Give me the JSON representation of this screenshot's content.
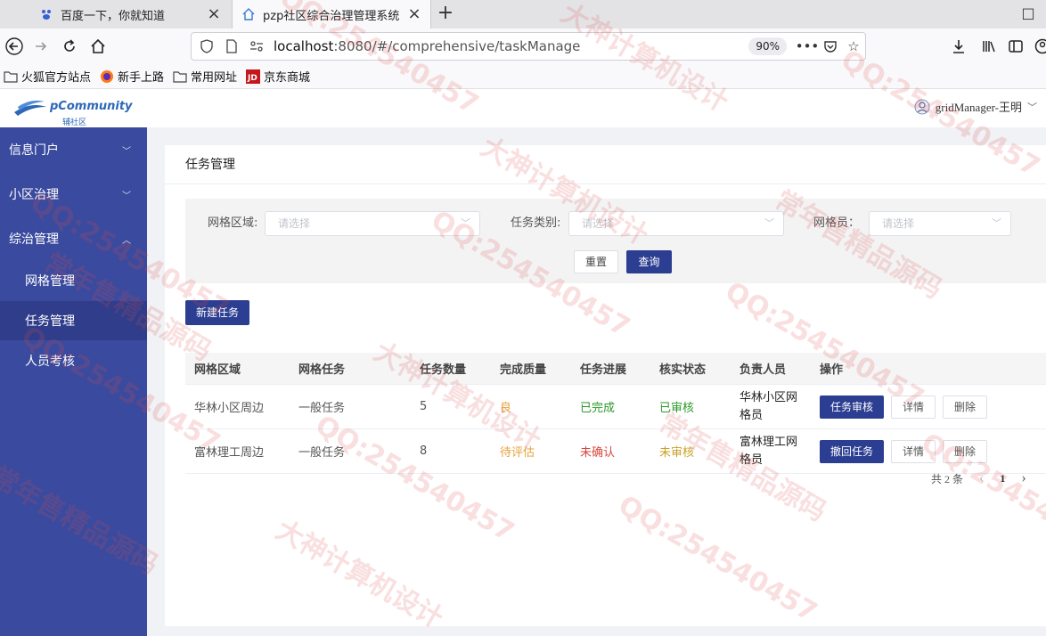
{
  "browser": {
    "tabs": [
      {
        "label": "百度一下，你就知道",
        "icon": "baidu-icon",
        "active": false
      },
      {
        "label": "pzp社区综合治理管理系统",
        "icon": "home-icon",
        "active": true
      }
    ],
    "url_host": "localhost",
    "url_rest": ":8080/#/comprehensive/taskManage",
    "zoom": "90%",
    "bookmarks": [
      {
        "label": "火狐官方站点",
        "icon": "folder-icon"
      },
      {
        "label": "新手上路",
        "icon": "firefox-icon"
      },
      {
        "label": "常用网址",
        "icon": "folder-icon"
      },
      {
        "label": "京东商城",
        "icon": "jd-icon"
      }
    ]
  },
  "app": {
    "logo_text": "pCommunity",
    "logo_sub": "辅社区",
    "user": "gridManager-王明"
  },
  "sidebar": {
    "items": [
      {
        "label": "信息门户",
        "expanded": false
      },
      {
        "label": "小区治理",
        "expanded": false
      },
      {
        "label": "综治管理",
        "expanded": true
      }
    ],
    "sub_items": [
      {
        "label": "网格管理",
        "active": false
      },
      {
        "label": "任务管理",
        "active": true
      },
      {
        "label": "人员考核",
        "active": false
      }
    ]
  },
  "page": {
    "title": "任务管理",
    "filters": {
      "area_label": "网格区域:",
      "area_placeholder": "请选择",
      "type_label": "任务类别:",
      "type_placeholder": "请选择",
      "member_label": "网格员：",
      "member_placeholder": "请选择"
    },
    "reset_label": "重置",
    "query_label": "查询",
    "new_task_label": "新建任务"
  },
  "table": {
    "headers": [
      "网格区域",
      "网格任务",
      "任务数量",
      "完成质量",
      "任务进展",
      "核实状态",
      "负责人员",
      "操作"
    ],
    "rows": [
      {
        "area": "华林小区周边",
        "task": "一般任务",
        "count": "5",
        "quality": "良",
        "progress": "已完成",
        "verify": "已审核",
        "owner": "华林小区网格员",
        "action_primary": "任务审核",
        "action_detail": "详情",
        "action_delete": "删除"
      },
      {
        "area": "富林理工周边",
        "task": "一般任务",
        "count": "8",
        "quality": "待评估",
        "progress": "未确认",
        "verify": "未审核",
        "owner": "富林理工网格员",
        "action_primary": "撤回任务",
        "action_detail": "详情",
        "action_delete": "删除"
      }
    ]
  },
  "pagination": {
    "total": "共 2 条",
    "prev": "‹",
    "page": "1",
    "next": "›"
  },
  "watermark": {
    "texts": [
      "大神计算机设计",
      "QQ:254540457",
      "常年售精品源码"
    ]
  },
  "colors": {
    "sidebar": "#3a4a9e",
    "primary_button": "#2c3e91",
    "status_green": "#2a9a2a",
    "status_red": "#d9463c",
    "status_orange": "#e6a23c"
  }
}
